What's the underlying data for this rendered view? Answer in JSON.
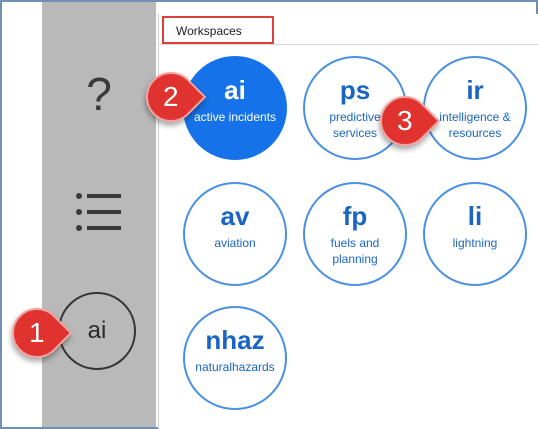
{
  "sidebar": {
    "help_glyph": "?",
    "avatar_initials": "ai"
  },
  "panel": {
    "title": "Workspaces"
  },
  "workspaces": [
    {
      "abbr": "ai",
      "desc": "active incidents"
    },
    {
      "abbr": "ps",
      "desc": "predictive services"
    },
    {
      "abbr": "ir",
      "desc": "intelligence & resources"
    },
    {
      "abbr": "av",
      "desc": "aviation"
    },
    {
      "abbr": "fp",
      "desc": "fuels and planning"
    },
    {
      "abbr": "li",
      "desc": "lightning"
    },
    {
      "abbr": "nhaz",
      "desc": "naturalhazards"
    }
  ],
  "callouts": [
    "1",
    "2",
    "3"
  ],
  "colors": {
    "accent": "#1672e8",
    "ring": "#4a90e2",
    "callout": "#e0332f",
    "sidebar": "#b9b9b9"
  }
}
